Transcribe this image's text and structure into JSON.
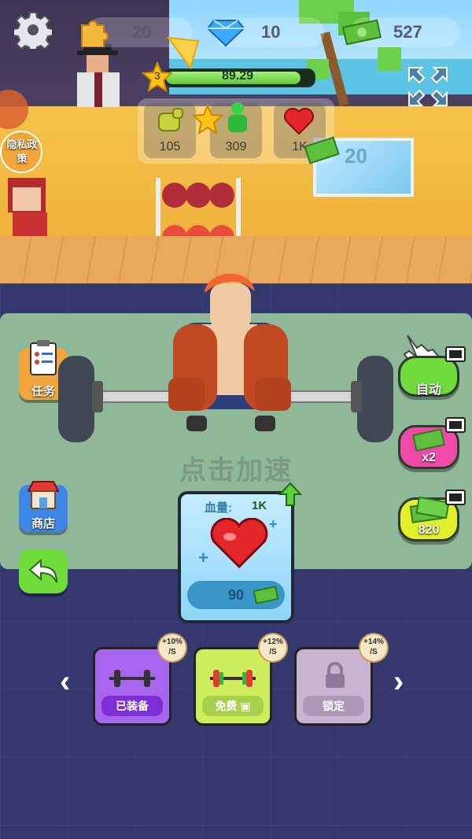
{
  "topbar": {
    "puzzle_count": "20",
    "gem_count": "10",
    "cash_count": "527"
  },
  "level": {
    "number": "3",
    "progress_value": "89.29",
    "progress_fraction": 0.92
  },
  "stats": [
    {
      "icon": "strength-fist-icon",
      "value": "105"
    },
    {
      "icon": "hero-power-icon",
      "value": "309"
    },
    {
      "icon": "heart-icon",
      "value": "1K"
    }
  ],
  "scene": {
    "window_number": "20"
  },
  "left_menu": {
    "privacy_label": "隐私政策",
    "tasks_label": "任务",
    "shop_label": "商店"
  },
  "right_menu": {
    "auto_label": "自动",
    "double_label": "x2",
    "cash_reward": "820"
  },
  "tap_hint": "点击加速",
  "upgrade_card": {
    "stat_label": "血量:",
    "stat_value": "1K",
    "price": "90"
  },
  "equipment": [
    {
      "bonus": "+10%",
      "unit": "/S",
      "label": "已装备",
      "color": "#a866ef"
    },
    {
      "bonus": "+12%",
      "unit": "/S",
      "label": "免费",
      "color": "#cfee5d"
    },
    {
      "bonus": "+14%",
      "unit": "/S",
      "label": "锁定",
      "color": "#c8b4d0"
    }
  ],
  "colors": {
    "green_button": "#6fdc3c",
    "pink_button": "#ef4aa8",
    "yellow_button": "#e3ef2a",
    "tile_floor": "#34386e"
  }
}
